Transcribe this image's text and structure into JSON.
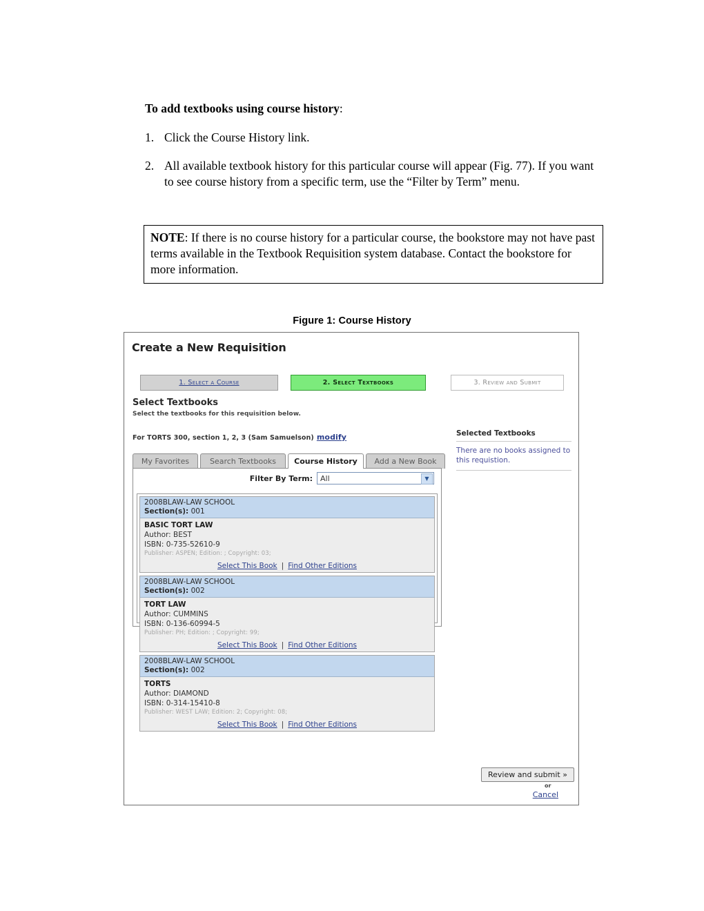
{
  "document": {
    "heading_bold": "To add textbooks using course history",
    "heading_colon": ":",
    "steps": [
      {
        "num": "1.",
        "text": "Click the Course History link."
      },
      {
        "num": "2.",
        "text": "All available textbook history for this particular course will appear (Fig. 77). If you want to see course history from a specific term, use the “Filter by Term” menu."
      }
    ],
    "note": {
      "label": "NOTE",
      "text": ":  If there is no course history for a particular course, the bookstore may not have past terms available in the Textbook Requisition system database. Contact the bookstore for more information."
    },
    "figure_caption": "Figure 1: Course History"
  },
  "screenshot": {
    "title": "Create a New Requisition",
    "wizard_steps": [
      {
        "label": "1. Select a Course",
        "state": "completed"
      },
      {
        "label": "2. Select Textbooks",
        "state": "active"
      },
      {
        "label": "3. Review and Submit",
        "state": "disabled"
      }
    ],
    "section": {
      "title": "Select Textbooks",
      "subtitle": "Select the textbooks for this requisition below.",
      "course_line": "For TORTS 300, section 1, 2, 3 (Sam Samuelson)",
      "modify_label": "modify"
    },
    "tabs": [
      {
        "label": "My Favorites",
        "active": false
      },
      {
        "label": "Search Textbooks",
        "active": false
      },
      {
        "label": "Course History",
        "active": true
      },
      {
        "label": "Add a New Book",
        "active": false
      }
    ],
    "filter": {
      "label": "Filter By Term:",
      "value": "All",
      "arrow_icon": "chevron-down-icon"
    },
    "books": [
      {
        "term": "2008BLAW-LAW SCHOOL",
        "section_label": "Section(s):",
        "section_value": "001",
        "title": "BASIC TORT LAW",
        "author": "Author: BEST",
        "isbn": "ISBN: 0-735-52610-9",
        "publisher": "Publisher: ASPEN; Edition: ; Copyright: 03;",
        "select_label": "Select This Book",
        "separator": "|",
        "editions_label": "Find Other Editions"
      },
      {
        "term": "2008BLAW-LAW SCHOOL",
        "section_label": "Section(s):",
        "section_value": "002",
        "title": "TORT LAW",
        "author": "Author: CUMMINS",
        "isbn": "ISBN: 0-136-60994-5",
        "publisher": "Publisher: PH; Edition: ; Copyright: 99;",
        "select_label": "Select This Book",
        "separator": "|",
        "editions_label": "Find Other Editions"
      },
      {
        "term": "2008BLAW-LAW SCHOOL",
        "section_label": "Section(s):",
        "section_value": "002",
        "title": "TORTS",
        "author": "Author: DIAMOND",
        "isbn": "ISBN: 0-314-15410-8",
        "publisher": "Publisher: WEST LAW; Edition: 2; Copyright: 08;",
        "select_label": "Select This Book",
        "separator": "|",
        "editions_label": "Find Other Editions"
      }
    ],
    "selected_panel": {
      "title": "Selected Textbooks",
      "empty_message": "There are no books assigned to this requistion."
    },
    "footer": {
      "review_label": "Review and submit »",
      "or_label": "or",
      "cancel_label": "Cancel"
    },
    "colors": {
      "active_step": "#7ceb7c",
      "completed_step": "#d2d2d2",
      "link": "#2b3f8c",
      "card_header": "#c2d7ee",
      "card_body": "#ededed",
      "empty_message": "#4b4f9b"
    }
  }
}
